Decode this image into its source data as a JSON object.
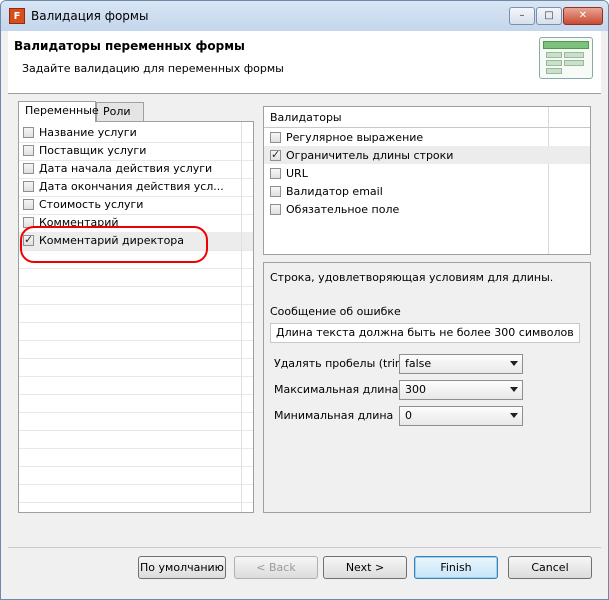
{
  "window": {
    "title": "Валидация формы",
    "controls": {
      "minimize": "–",
      "maximize": "□",
      "close": "✕"
    },
    "app_icon_letter": "F"
  },
  "header": {
    "title": "Валидаторы переменных формы",
    "subtitle": "Задайте валидацию для переменных формы"
  },
  "tabs": [
    {
      "label": "Переменные",
      "active": true
    },
    {
      "label": "Роли",
      "active": false
    }
  ],
  "variables": [
    {
      "label": "Название услуги",
      "checked": false
    },
    {
      "label": "Поставщик услуги",
      "checked": false
    },
    {
      "label": "Дата начала действия услуги",
      "checked": false
    },
    {
      "label": "Дата окончания действия усл...",
      "checked": false
    },
    {
      "label": "Стоимость услуги",
      "checked": false
    },
    {
      "label": "Комментарий",
      "checked": false
    },
    {
      "label": "Комментарий директора",
      "checked": true
    }
  ],
  "validators": {
    "header": "Валидаторы",
    "items": [
      {
        "label": "Регулярное выражение",
        "checked": false
      },
      {
        "label": "Ограничитель длины строки",
        "checked": true
      },
      {
        "label": "URL",
        "checked": false
      },
      {
        "label": "Валидатор email",
        "checked": false
      },
      {
        "label": "Обязательное поле",
        "checked": false
      }
    ]
  },
  "details": {
    "description": "Строка, удовлетворяющая условиям для длины.",
    "error_label": "Сообщение об ошибке",
    "error_message": "Длина текста должна быть не более 300 символов",
    "trim_label": "Удалять пробелы (trim)",
    "trim_value": "false",
    "max_label": "Максимальная длина",
    "max_value": "300",
    "min_label": "Минимальная длина",
    "min_value": "0"
  },
  "buttons": {
    "defaults": "По умолчанию",
    "back": "< Back",
    "next": "Next >",
    "finish": "Finish",
    "cancel": "Cancel"
  },
  "colors": {
    "highlight": "#e00000",
    "selected_row": "#e8e8e8"
  }
}
